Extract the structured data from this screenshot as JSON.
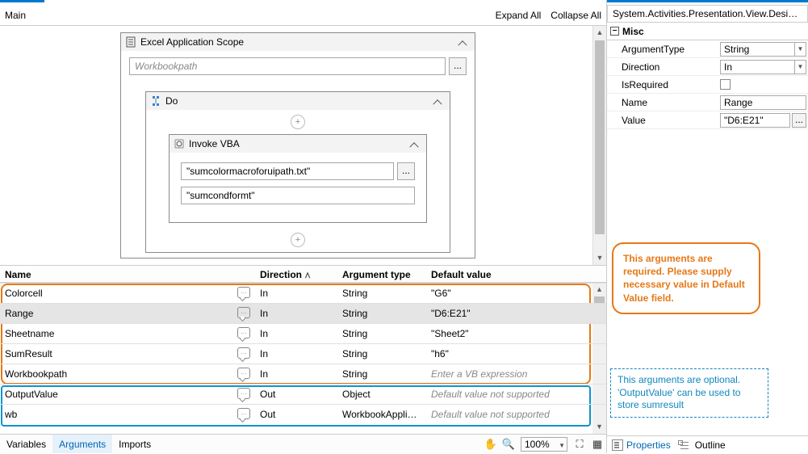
{
  "header": {
    "tab": "Main",
    "expand": "Expand All",
    "collapse": "Collapse All"
  },
  "activities": {
    "scope": {
      "title": "Excel Application Scope",
      "workbook_placeholder": "Workbookpath"
    },
    "do": {
      "title": "Do"
    },
    "invoke": {
      "title": "Invoke VBA",
      "file": "\"sumcolormacroforuipath.txt\"",
      "macro": "\"sumcondformt\""
    }
  },
  "grid": {
    "cols": {
      "name": "Name",
      "dir": "Direction",
      "type": "Argument type",
      "default": "Default value"
    },
    "rows": [
      {
        "name": "Colorcell",
        "dir": "In",
        "type": "String",
        "default": "\"G6\"",
        "placeholder": false,
        "selected": false
      },
      {
        "name": "Range",
        "dir": "In",
        "type": "String",
        "default": "\"D6:E21\"",
        "placeholder": false,
        "selected": true
      },
      {
        "name": "Sheetname",
        "dir": "In",
        "type": "String",
        "default": "\"Sheet2\"",
        "placeholder": false,
        "selected": false
      },
      {
        "name": "SumResult",
        "dir": "In",
        "type": "String",
        "default": "\"h6\"",
        "placeholder": false,
        "selected": false
      },
      {
        "name": "Workbookpath",
        "dir": "In",
        "type": "String",
        "default": "Enter a VB expression",
        "placeholder": true,
        "selected": false
      },
      {
        "name": "OutputValue",
        "dir": "Out",
        "type": "Object",
        "default": "Default value not supported",
        "placeholder": true,
        "selected": false
      },
      {
        "name": "wb",
        "dir": "Out",
        "type": "WorkbookApplicati",
        "default": "Default value not supported",
        "placeholder": true,
        "selected": false
      }
    ]
  },
  "bottom": {
    "tabs": {
      "variables": "Variables",
      "arguments": "Arguments",
      "imports": "Imports"
    },
    "zoom": "100%"
  },
  "props": {
    "header": "System.Activities.Presentation.View.Design...",
    "cat": "Misc",
    "items": {
      "argType": {
        "label": "ArgumentType",
        "value": "String"
      },
      "direction": {
        "label": "Direction",
        "value": "In"
      },
      "isRequired": {
        "label": "IsRequired"
      },
      "name": {
        "label": "Name",
        "value": "Range"
      },
      "value": {
        "label": "Value",
        "value": "\"D6:E21\""
      }
    },
    "tabs": {
      "properties": "Properties",
      "outline": "Outline"
    }
  },
  "anno": {
    "required_pre": "This arguments are required. Please supply necessary value in ",
    "required_bold": "Default Value",
    "required_post": " field.",
    "optional": "This arguments are optional. 'OutputValue' can be used to store sumresult"
  }
}
